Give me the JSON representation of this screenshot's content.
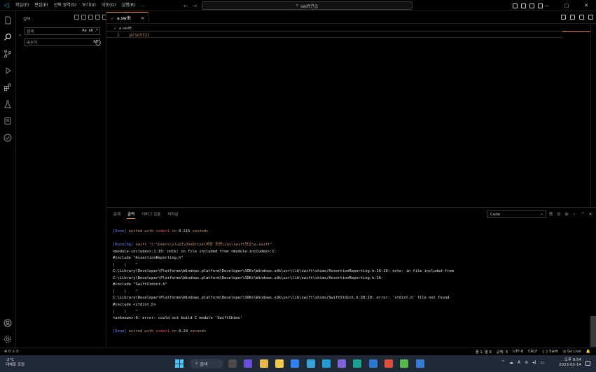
{
  "titlebar": {
    "menu": [
      "파일(F)",
      "편집(E)",
      "선택 영역(S)",
      "보기(V)",
      "이동(G)",
      "실행(R)",
      "..."
    ],
    "command_center": "swift연습",
    "window_controls": [
      "—",
      "▢",
      "✕"
    ]
  },
  "activity_icons": [
    "explorer-icon",
    "search-icon",
    "source-control-icon",
    "run-debug-icon",
    "extensions-icon",
    "testing-icon",
    "remote-icon",
    "swift-icon",
    "account-icon",
    "settings-icon"
  ],
  "sidebar": {
    "title": "검색",
    "search_value": "검색",
    "search_options": [
      "Aa",
      "ab",
      ".*"
    ],
    "replace_value": "바꾸기",
    "replace_option": "AB"
  },
  "editor": {
    "tab_label": "a.swift",
    "tab_close": "✕",
    "breadcrumb": "a.swift",
    "line_number": "1",
    "code": "print(1)"
  },
  "panel": {
    "tabs": [
      "문제",
      "출력",
      "디버그 콘솔",
      "터미널"
    ],
    "active_tab": "출력",
    "channel": "Code",
    "output": [
      {
        "segs": [
          {
            "t": "[Done] ",
            "c": "c-blue"
          },
          {
            "t": "exited with ",
            "c": "c-orange"
          },
          {
            "t": "code=1",
            "c": "c-red"
          },
          {
            "t": " in ",
            "c": "c-orange"
          },
          {
            "t": "0.215",
            "c": "c-white"
          },
          {
            "t": " seconds",
            "c": "c-orange"
          }
        ]
      },
      {
        "segs": []
      },
      {
        "segs": [
          {
            "t": "[Running] ",
            "c": "c-blue"
          },
          {
            "t": "swift \"c:\\Users\\ilu23\\OneDrive\\바탕 화면\\ios\\swift연습\\a.swift\"",
            "c": "c-orange"
          }
        ]
      },
      {
        "segs": [
          {
            "t": "<module-includes>:1:10: note: in file included from <module-includes>:1:",
            "c": "c-white"
          }
        ]
      },
      {
        "segs": [
          {
            "t": "#include \"AssertionReporting.h\"",
            "c": "c-white"
          }
        ]
      },
      {
        "segs": [
          {
            "t": "|    |    ^",
            "c": "c-gray"
          }
        ]
      },
      {
        "segs": [
          {
            "t": "C:\\Library\\Developer\\Platforms\\Windows.platform\\Developer\\SDKs\\Windows.sdk\\usr\\lib\\swift\\shims/AssertionReporting.h:16:10: note: in file included from",
            "c": "c-white"
          }
        ]
      },
      {
        "segs": [
          {
            "t": "C:\\Library\\Developer\\Platforms\\Windows.platform\\Developer\\SDKs\\Windows.sdk\\usr\\lib\\swift\\shims/AssertionReporting.h:16:",
            "c": "c-white"
          }
        ]
      },
      {
        "segs": [
          {
            "t": "#include \"SwiftStdint.h\"",
            "c": "c-white"
          }
        ]
      },
      {
        "segs": [
          {
            "t": "|    |    ^",
            "c": "c-gray"
          }
        ]
      },
      {
        "segs": [
          {
            "t": "C:\\Library\\Developer\\Platforms\\Windows.platform\\Developer\\SDKs\\Windows.sdk\\usr\\lib\\swift\\shims/SwiftStdint.h:28:10: error: 'stdint.h' file not found",
            "c": "c-white"
          }
        ]
      },
      {
        "segs": [
          {
            "t": "#include <stdint.h>",
            "c": "c-white"
          }
        ]
      },
      {
        "segs": [
          {
            "t": "|    |    ^",
            "c": "c-gray"
          }
        ]
      },
      {
        "segs": [
          {
            "t": "<unknown>:0: error: could not build C module 'SwiftShims'",
            "c": "c-white"
          }
        ]
      },
      {
        "segs": []
      },
      {
        "segs": [
          {
            "t": "[Done] ",
            "c": "c-blue"
          },
          {
            "t": "exited with ",
            "c": "c-orange"
          },
          {
            "t": "code=1",
            "c": "c-red"
          },
          {
            "t": " in ",
            "c": "c-orange"
          },
          {
            "t": "0.24",
            "c": "c-white"
          },
          {
            "t": " seconds",
            "c": "c-orange"
          }
        ]
      }
    ]
  },
  "statusbar": {
    "problems": "⊗ 0  ⚠ 0",
    "position": "줄 1, 열 9",
    "spaces": "공백: 4",
    "encoding": "UTF-8",
    "eol": "CRLF",
    "language": "{ } Swift",
    "golive": "◎ Go Live"
  },
  "taskbar": {
    "temperature": "-2°C",
    "weather_text": "대체로 조림",
    "search_label": "검색",
    "time": "오후 9:54",
    "date": "2023-02-14",
    "app_colors": [
      "#4a4a4a",
      "#6b4fd8",
      "#e8b84a",
      "#f2c94c",
      "#2f80ed",
      "#3aa0d8",
      "#1f9bd7",
      "#7d62d8",
      "#19a38f",
      "#2a78d2",
      "#e04c3b",
      "#57b847",
      "#3a7bd5"
    ]
  }
}
